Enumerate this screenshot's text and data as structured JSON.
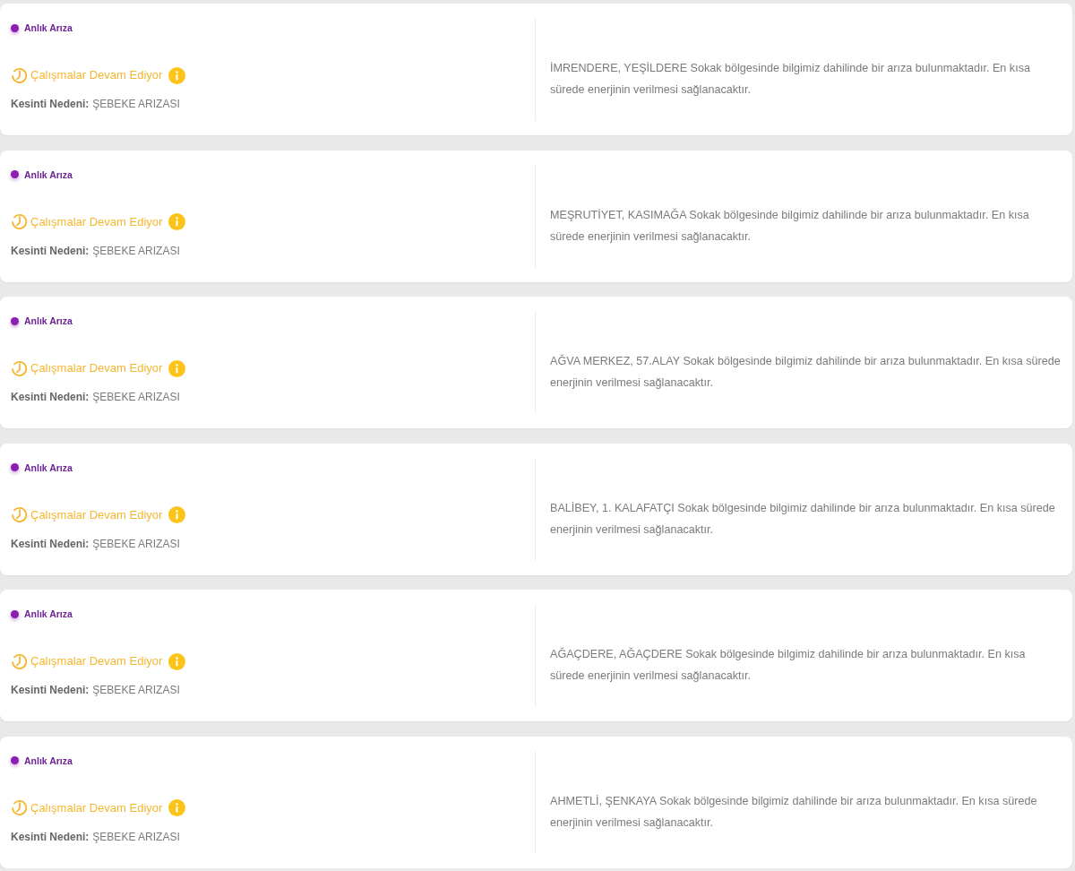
{
  "outages": [
    {
      "status": "Anlık Arıza",
      "progress": "Çalışmalar Devam Ediyor",
      "reason_label": "Kesinti Nedeni:",
      "reason": "ŞEBEKE ARIZASI",
      "description": "İMRENDERE, YEŞİLDERE Sokak bölgesinde bilgimiz dahilinde bir arıza bulunmaktadır. En kısa sürede enerjinin verilmesi sağlanacaktır."
    },
    {
      "status": "Anlık Arıza",
      "progress": "Çalışmalar Devam Ediyor",
      "reason_label": "Kesinti Nedeni:",
      "reason": "ŞEBEKE ARIZASI",
      "description": "MEŞRUTİYET, KASIMAĞA Sokak bölgesinde bilgimiz dahilinde bir arıza bulunmaktadır. En kısa sürede enerjinin verilmesi sağlanacaktır."
    },
    {
      "status": "Anlık Arıza",
      "progress": "Çalışmalar Devam Ediyor",
      "reason_label": "Kesinti Nedeni:",
      "reason": "ŞEBEKE ARIZASI",
      "description": "AĞVA MERKEZ, 57.ALAY Sokak bölgesinde bilgimiz dahilinde bir arıza bulunmaktadır. En kısa sürede enerjinin verilmesi sağlanacaktır."
    },
    {
      "status": "Anlık Arıza",
      "progress": "Çalışmalar Devam Ediyor",
      "reason_label": "Kesinti Nedeni:",
      "reason": "ŞEBEKE ARIZASI",
      "description": "BALİBEY, 1. KALAFATÇI Sokak bölgesinde bilgimiz dahilinde bir arıza bulunmaktadır. En kısa sürede enerjinin verilmesi sağlanacaktır."
    },
    {
      "status": "Anlık Arıza",
      "progress": "Çalışmalar Devam Ediyor",
      "reason_label": "Kesinti Nedeni:",
      "reason": "ŞEBEKE ARIZASI",
      "description": "AĞAÇDERE, AĞAÇDERE Sokak bölgesinde bilgimiz dahilinde bir arıza bulunmaktadır. En kısa sürede enerjinin verilmesi sağlanacaktır."
    },
    {
      "status": "Anlık Arıza",
      "progress": "Çalışmalar Devam Ediyor",
      "reason_label": "Kesinti Nedeni:",
      "reason": "ŞEBEKE ARIZASI",
      "description": "AHMETLİ, ŞENKAYA Sokak bölgesinde bilgimiz dahilinde bir arıza bulunmaktadır. En kısa sürede enerjinin verilmesi sağlanacaktır."
    }
  ]
}
